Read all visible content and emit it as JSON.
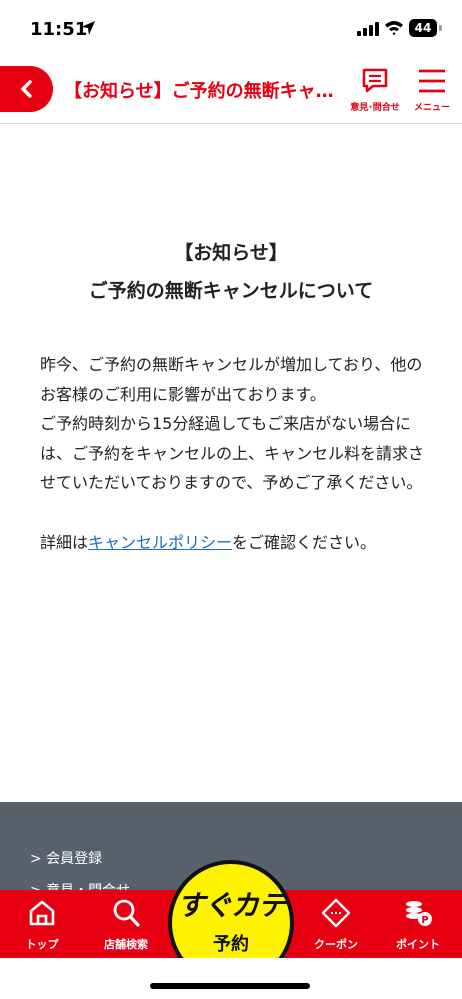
{
  "status_bar": {
    "time": "11:51",
    "battery": "44"
  },
  "header": {
    "title": "【お知らせ】ご予約の無断キャンセルについて",
    "feedback_label": "意見･問合せ",
    "menu_label": "メニュー",
    "accent_color": "#e60012"
  },
  "article": {
    "heading_line1": "【お知らせ】",
    "heading_line2": "ご予約の無断キャンセルについて",
    "paragraph1": "昨今、ご予約の無断キャンセルが増加しており、他のお客様のご利用に影響が出ております。",
    "paragraph2": "ご予約時刻から15分経過してもご来店がない場合には、ご予約をキャンセルの上、キャンセル料を請求させていただいておりますので、予めご了承ください。",
    "detail_prefix": "詳細は",
    "detail_link": "キャンセルポリシー",
    "detail_suffix": "をご確認ください。",
    "link_color": "#1a6fc4"
  },
  "footer": {
    "items": [
      "> 会員登録",
      "> 意見・問合せ"
    ]
  },
  "tab_bar": {
    "tabs": [
      {
        "label": "トップ",
        "icon": "home-icon"
      },
      {
        "label": "店舗検索",
        "icon": "search-icon"
      },
      {
        "label": "クーポン",
        "icon": "coupon-icon"
      },
      {
        "label": "ポイント",
        "icon": "point-icon"
      }
    ],
    "center_line1": "すぐカテ",
    "center_line2": "予約"
  }
}
